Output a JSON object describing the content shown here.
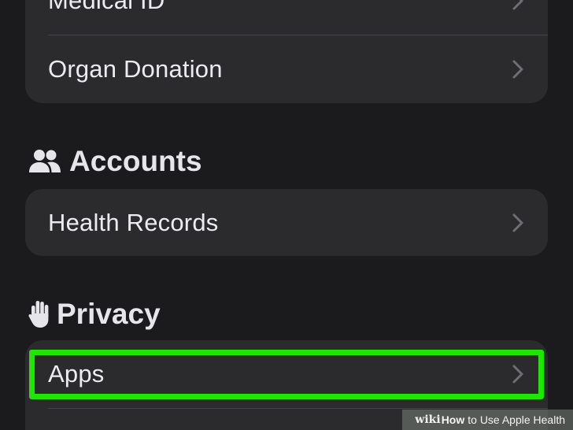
{
  "top_group": {
    "items": [
      {
        "label": "Medical ID"
      },
      {
        "label": "Organ Donation"
      }
    ]
  },
  "accounts": {
    "title": "Accounts",
    "icon": "people-icon",
    "items": [
      {
        "label": "Health Records"
      }
    ]
  },
  "privacy": {
    "title": "Privacy",
    "icon": "hand-icon",
    "items": [
      {
        "label": "Apps"
      }
    ]
  },
  "colors": {
    "background": "#1b1b1d",
    "group_fill": "#2b2b2e",
    "highlight": "#1ee600",
    "chevron": "#6e6e73"
  },
  "watermark": {
    "brand": "wiki",
    "how": "How",
    "rest": "to Use Apple Health"
  }
}
